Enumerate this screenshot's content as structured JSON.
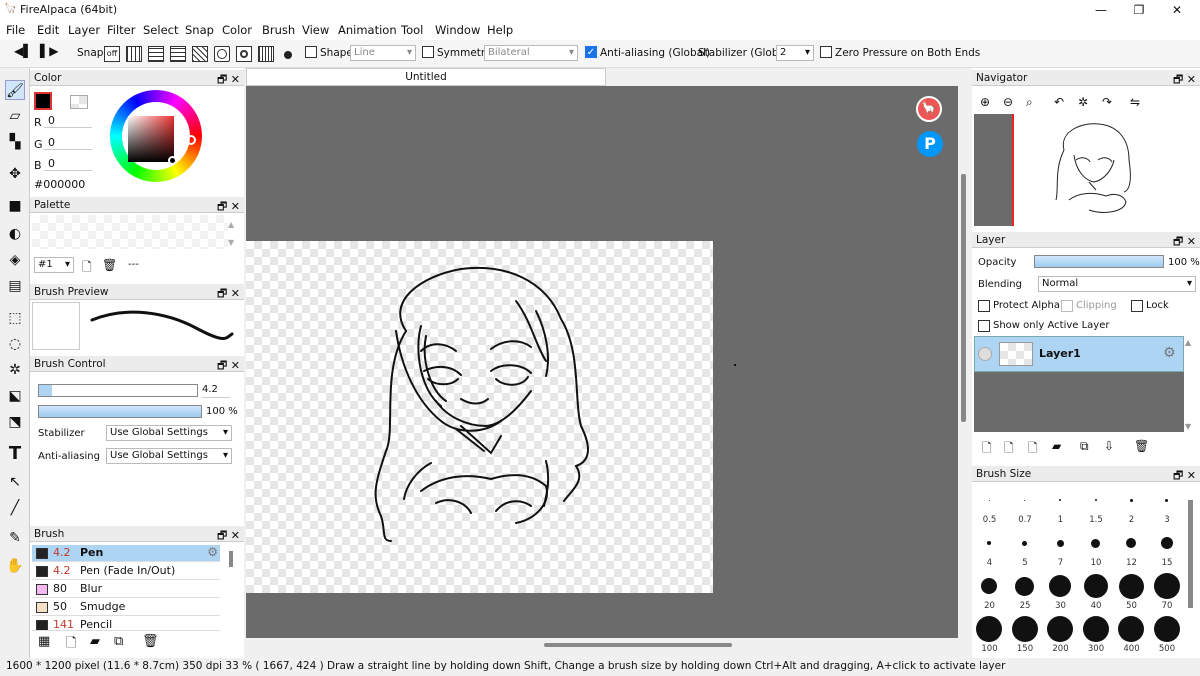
{
  "window": {
    "title": "FireAlpaca (64bit)",
    "minimize": "—",
    "maximize": "❐",
    "close": "✕"
  },
  "menu": [
    "File",
    "Edit",
    "Layer",
    "Filter",
    "Select",
    "Snap",
    "Color",
    "Brush",
    "View",
    "Animation",
    "Tool",
    "Window",
    "Help"
  ],
  "toolbar": {
    "snap_label": "Snap",
    "snap_off": "off",
    "shape_label": "Shape",
    "shape_value": "Line",
    "symmetry_label": "Symmetry",
    "symmetry_value": "Bilateral",
    "antialias_label": "Anti-aliasing (Global)",
    "antialias_checked": true,
    "stabilizer_label": "Stabilizer (Global)",
    "stabilizer_value": "2",
    "zero_pressure_label": "Zero Pressure on Both Ends"
  },
  "color_panel": {
    "title": "Color",
    "r_label": "R",
    "r": "0",
    "g_label": "G",
    "g": "0",
    "b_label": "B",
    "b": "0",
    "hex": "#000000",
    "fg_color": "#000000"
  },
  "palette_panel": {
    "title": "Palette",
    "palette_select": "#1",
    "name": "---"
  },
  "brush_preview": {
    "title": "Brush Preview"
  },
  "brush_control": {
    "title": "Brush Control",
    "size": "4.2",
    "opacity": "100 %",
    "stabilizer_label": "Stabilizer",
    "stabilizer_value": "Use Global Settings",
    "antialias_label": "Anti-aliasing",
    "antialias_value": "Use Global Settings"
  },
  "brush_panel": {
    "title": "Brush",
    "brushes": [
      {
        "size": "4.2",
        "name": "Pen",
        "color": "#222222",
        "selected": true
      },
      {
        "size": "4.2",
        "name": "Pen (Fade In/Out)",
        "color": "#222222",
        "selected": false
      },
      {
        "size": "80",
        "name": "Blur",
        "color": "#f3b8f0",
        "selected": false
      },
      {
        "size": "50",
        "name": "Smudge",
        "color": "#f7e0c8",
        "selected": false
      },
      {
        "size": "141",
        "name": "Pencil",
        "color": "#222222",
        "selected": false
      }
    ]
  },
  "canvas": {
    "tab_title": "Untitled"
  },
  "navigator": {
    "title": "Navigator"
  },
  "layer_panel": {
    "title": "Layer",
    "opacity_label": "Opacity",
    "opacity_value": "100 %",
    "blending_label": "Blending",
    "blending_value": "Normal",
    "protect_alpha": "Protect Alpha",
    "clipping": "Clipping",
    "lock": "Lock",
    "show_active": "Show only Active Layer",
    "layer_name": "Layer1"
  },
  "brush_size_panel": {
    "title": "Brush Size",
    "sizes": [
      "0.5",
      "0.7",
      "1",
      "1.5",
      "2",
      "3",
      "4",
      "5",
      "7",
      "10",
      "12",
      "15",
      "20",
      "25",
      "30",
      "40",
      "50",
      "70",
      "100",
      "150",
      "200",
      "300",
      "400",
      "500"
    ]
  },
  "status": {
    "text": "1600 * 1200 pixel   (11.6 * 8.7cm)  350 dpi  33 %   ( 1667, 424 )   Draw a straight line by holding down Shift, Change a brush size by holding down Ctrl+Alt and dragging, A+click to activate layer"
  },
  "float_icons": {
    "p_letter": "P"
  }
}
